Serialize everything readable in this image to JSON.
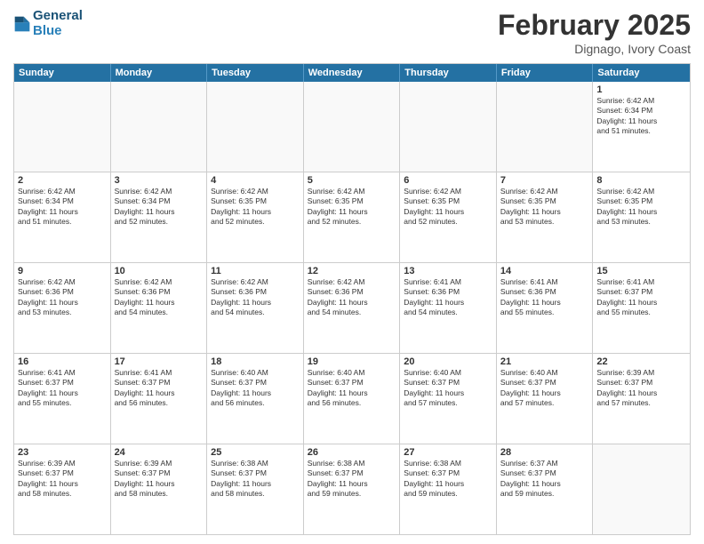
{
  "header": {
    "logo_line1": "General",
    "logo_line2": "Blue",
    "month": "February 2025",
    "location": "Dignago, Ivory Coast"
  },
  "weekdays": [
    "Sunday",
    "Monday",
    "Tuesday",
    "Wednesday",
    "Thursday",
    "Friday",
    "Saturday"
  ],
  "rows": [
    [
      {
        "day": "",
        "text": ""
      },
      {
        "day": "",
        "text": ""
      },
      {
        "day": "",
        "text": ""
      },
      {
        "day": "",
        "text": ""
      },
      {
        "day": "",
        "text": ""
      },
      {
        "day": "",
        "text": ""
      },
      {
        "day": "1",
        "text": "Sunrise: 6:42 AM\nSunset: 6:34 PM\nDaylight: 11 hours\nand 51 minutes."
      }
    ],
    [
      {
        "day": "2",
        "text": "Sunrise: 6:42 AM\nSunset: 6:34 PM\nDaylight: 11 hours\nand 51 minutes."
      },
      {
        "day": "3",
        "text": "Sunrise: 6:42 AM\nSunset: 6:34 PM\nDaylight: 11 hours\nand 52 minutes."
      },
      {
        "day": "4",
        "text": "Sunrise: 6:42 AM\nSunset: 6:35 PM\nDaylight: 11 hours\nand 52 minutes."
      },
      {
        "day": "5",
        "text": "Sunrise: 6:42 AM\nSunset: 6:35 PM\nDaylight: 11 hours\nand 52 minutes."
      },
      {
        "day": "6",
        "text": "Sunrise: 6:42 AM\nSunset: 6:35 PM\nDaylight: 11 hours\nand 52 minutes."
      },
      {
        "day": "7",
        "text": "Sunrise: 6:42 AM\nSunset: 6:35 PM\nDaylight: 11 hours\nand 53 minutes."
      },
      {
        "day": "8",
        "text": "Sunrise: 6:42 AM\nSunset: 6:35 PM\nDaylight: 11 hours\nand 53 minutes."
      }
    ],
    [
      {
        "day": "9",
        "text": "Sunrise: 6:42 AM\nSunset: 6:36 PM\nDaylight: 11 hours\nand 53 minutes."
      },
      {
        "day": "10",
        "text": "Sunrise: 6:42 AM\nSunset: 6:36 PM\nDaylight: 11 hours\nand 54 minutes."
      },
      {
        "day": "11",
        "text": "Sunrise: 6:42 AM\nSunset: 6:36 PM\nDaylight: 11 hours\nand 54 minutes."
      },
      {
        "day": "12",
        "text": "Sunrise: 6:42 AM\nSunset: 6:36 PM\nDaylight: 11 hours\nand 54 minutes."
      },
      {
        "day": "13",
        "text": "Sunrise: 6:41 AM\nSunset: 6:36 PM\nDaylight: 11 hours\nand 54 minutes."
      },
      {
        "day": "14",
        "text": "Sunrise: 6:41 AM\nSunset: 6:36 PM\nDaylight: 11 hours\nand 55 minutes."
      },
      {
        "day": "15",
        "text": "Sunrise: 6:41 AM\nSunset: 6:37 PM\nDaylight: 11 hours\nand 55 minutes."
      }
    ],
    [
      {
        "day": "16",
        "text": "Sunrise: 6:41 AM\nSunset: 6:37 PM\nDaylight: 11 hours\nand 55 minutes."
      },
      {
        "day": "17",
        "text": "Sunrise: 6:41 AM\nSunset: 6:37 PM\nDaylight: 11 hours\nand 56 minutes."
      },
      {
        "day": "18",
        "text": "Sunrise: 6:40 AM\nSunset: 6:37 PM\nDaylight: 11 hours\nand 56 minutes."
      },
      {
        "day": "19",
        "text": "Sunrise: 6:40 AM\nSunset: 6:37 PM\nDaylight: 11 hours\nand 56 minutes."
      },
      {
        "day": "20",
        "text": "Sunrise: 6:40 AM\nSunset: 6:37 PM\nDaylight: 11 hours\nand 57 minutes."
      },
      {
        "day": "21",
        "text": "Sunrise: 6:40 AM\nSunset: 6:37 PM\nDaylight: 11 hours\nand 57 minutes."
      },
      {
        "day": "22",
        "text": "Sunrise: 6:39 AM\nSunset: 6:37 PM\nDaylight: 11 hours\nand 57 minutes."
      }
    ],
    [
      {
        "day": "23",
        "text": "Sunrise: 6:39 AM\nSunset: 6:37 PM\nDaylight: 11 hours\nand 58 minutes."
      },
      {
        "day": "24",
        "text": "Sunrise: 6:39 AM\nSunset: 6:37 PM\nDaylight: 11 hours\nand 58 minutes."
      },
      {
        "day": "25",
        "text": "Sunrise: 6:38 AM\nSunset: 6:37 PM\nDaylight: 11 hours\nand 58 minutes."
      },
      {
        "day": "26",
        "text": "Sunrise: 6:38 AM\nSunset: 6:37 PM\nDaylight: 11 hours\nand 59 minutes."
      },
      {
        "day": "27",
        "text": "Sunrise: 6:38 AM\nSunset: 6:37 PM\nDaylight: 11 hours\nand 59 minutes."
      },
      {
        "day": "28",
        "text": "Sunrise: 6:37 AM\nSunset: 6:37 PM\nDaylight: 11 hours\nand 59 minutes."
      },
      {
        "day": "",
        "text": ""
      }
    ]
  ]
}
